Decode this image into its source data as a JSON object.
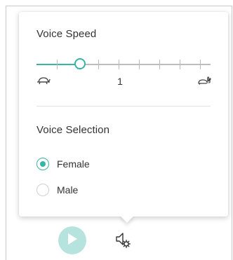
{
  "voice_speed": {
    "title": "Voice Speed",
    "value": "1",
    "slider_level": 0.25,
    "tick_count": 8,
    "slow_icon": "turtle-icon",
    "fast_icon": "rabbit-icon"
  },
  "voice_selection": {
    "title": "Voice Selection",
    "options": [
      {
        "label": "Female",
        "checked": true
      },
      {
        "label": "Male",
        "checked": false
      }
    ]
  },
  "controls": {
    "play_icon": "play-icon",
    "settings_icon": "speaker-settings-icon"
  },
  "colors": {
    "accent": "#38b3a4",
    "play_button": "#b7e3de",
    "track": "#bdbdbd"
  }
}
